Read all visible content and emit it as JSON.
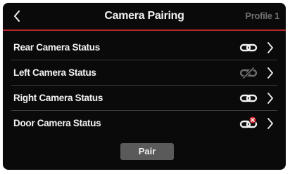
{
  "header": {
    "title": "Camera Pairing",
    "profile_label": "Profile 1",
    "back_icon": "chevron-left-icon"
  },
  "cameras": [
    {
      "label": "Rear Camera Status",
      "status": "linked",
      "status_icon": "link-icon"
    },
    {
      "label": "Left Camera Status",
      "status": "unlinked",
      "status_icon": "link-broken-icon"
    },
    {
      "label": "Right Camera Status",
      "status": "linked",
      "status_icon": "link-icon"
    },
    {
      "label": "Door Camera Status",
      "status": "error",
      "status_icon": "link-error-icon"
    }
  ],
  "pair_button_label": "Pair",
  "colors": {
    "background": "#0a0a0a",
    "accent": "#b3262b",
    "text": "#f2f2f2",
    "muted": "#6e6e6e",
    "button": "#5a5a5a",
    "error": "#d9252c"
  }
}
